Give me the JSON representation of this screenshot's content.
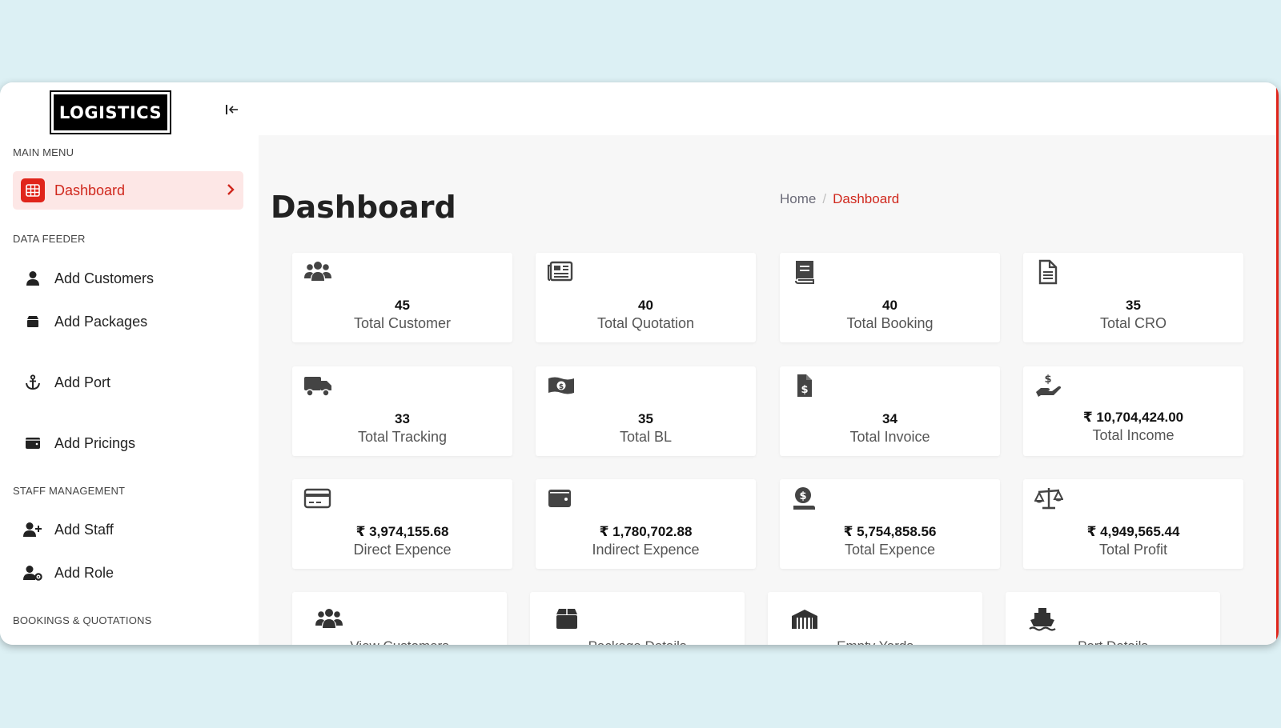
{
  "app": {
    "logo_text": "LOGISTICS"
  },
  "sidebar": {
    "sections": [
      {
        "title": "MAIN MENU"
      },
      {
        "title": "DATA FEEDER"
      },
      {
        "title": "STAFF MANAGEMENT"
      },
      {
        "title": "BOOKINGS & QUOTATIONS"
      }
    ],
    "items": [
      {
        "label": "Dashboard",
        "icon": "grid-icon",
        "active": true
      },
      {
        "label": "Add Customers",
        "icon": "user-icon"
      },
      {
        "label": "Add Packages",
        "icon": "box-icon"
      },
      {
        "label": "Add Port",
        "icon": "anchor-icon"
      },
      {
        "label": "Add Pricings",
        "icon": "wallet-icon"
      },
      {
        "label": "Add Staff",
        "icon": "user-plus-icon"
      },
      {
        "label": "Add Role",
        "icon": "user-gear-icon"
      }
    ]
  },
  "header": {
    "title": "Dashboard",
    "breadcrumb": {
      "home": "Home",
      "separator": "/",
      "current": "Dashboard"
    }
  },
  "stats": [
    {
      "value": "45",
      "label": "Total Customer",
      "icon": "users-icon"
    },
    {
      "value": "40",
      "label": "Total Quotation",
      "icon": "newspaper-icon"
    },
    {
      "value": "40",
      "label": "Total Booking",
      "icon": "book-icon"
    },
    {
      "value": "35",
      "label": "Total CRO",
      "icon": "file-icon"
    },
    {
      "value": "33",
      "label": "Total Tracking",
      "icon": "truck-icon"
    },
    {
      "value": "35",
      "label": "Total BL",
      "icon": "money-bill-icon"
    },
    {
      "value": "34",
      "label": "Total Invoice",
      "icon": "file-invoice-icon"
    },
    {
      "value": "₹ 10,704,424.00",
      "label": "Total Income",
      "icon": "hand-dollar-icon"
    },
    {
      "value": "₹ 3,974,155.68",
      "label": "Direct Expence",
      "icon": "credit-card-icon"
    },
    {
      "value": "₹ 1,780,702.88",
      "label": "Indirect Expence",
      "icon": "wallet-icon"
    },
    {
      "value": "₹ 5,754,858.56",
      "label": "Total Expence",
      "icon": "money-bag-icon"
    },
    {
      "value": "₹ 4,949,565.44",
      "label": "Total Profit",
      "icon": "scale-icon"
    }
  ],
  "quick_links": [
    {
      "label": "View Customers",
      "icon": "users-icon"
    },
    {
      "label": "Package Details",
      "icon": "box-icon"
    },
    {
      "label": "Empty Yards",
      "icon": "warehouse-icon"
    },
    {
      "label": "Port Details",
      "icon": "ship-icon"
    }
  ],
  "colors": {
    "accent": "#e0251b",
    "active_bg": "#fde7e6",
    "page_bg": "#dcf0f4",
    "icon": "#444444"
  }
}
